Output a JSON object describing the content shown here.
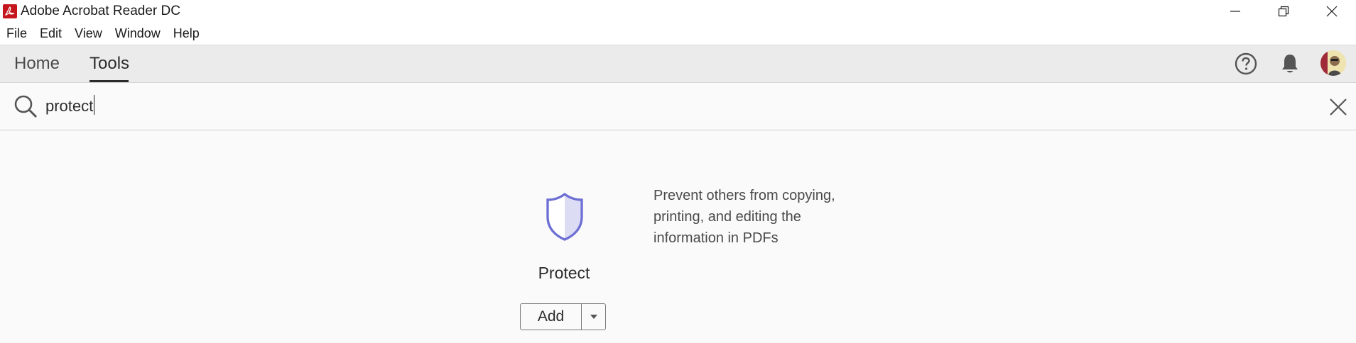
{
  "window": {
    "title": "Adobe Acrobat Reader DC",
    "controls": [
      "minimize-icon",
      "restore-icon",
      "close-icon"
    ]
  },
  "menu": {
    "items": [
      "File",
      "Edit",
      "View",
      "Window",
      "Help"
    ]
  },
  "tabs": {
    "items": [
      {
        "label": "Home",
        "active": false
      },
      {
        "label": "Tools",
        "active": true
      }
    ],
    "right_icons": [
      "help-icon",
      "bell-icon",
      "avatar"
    ]
  },
  "search": {
    "value": "protect",
    "icon": "search-icon",
    "clear_icon": "close-icon"
  },
  "result": {
    "icon": "shield-icon",
    "name": "Protect",
    "description": "Prevent others from copying, printing, and editing the information in PDFs",
    "add_label": "Add",
    "accent_color": "#6c6fd4"
  }
}
